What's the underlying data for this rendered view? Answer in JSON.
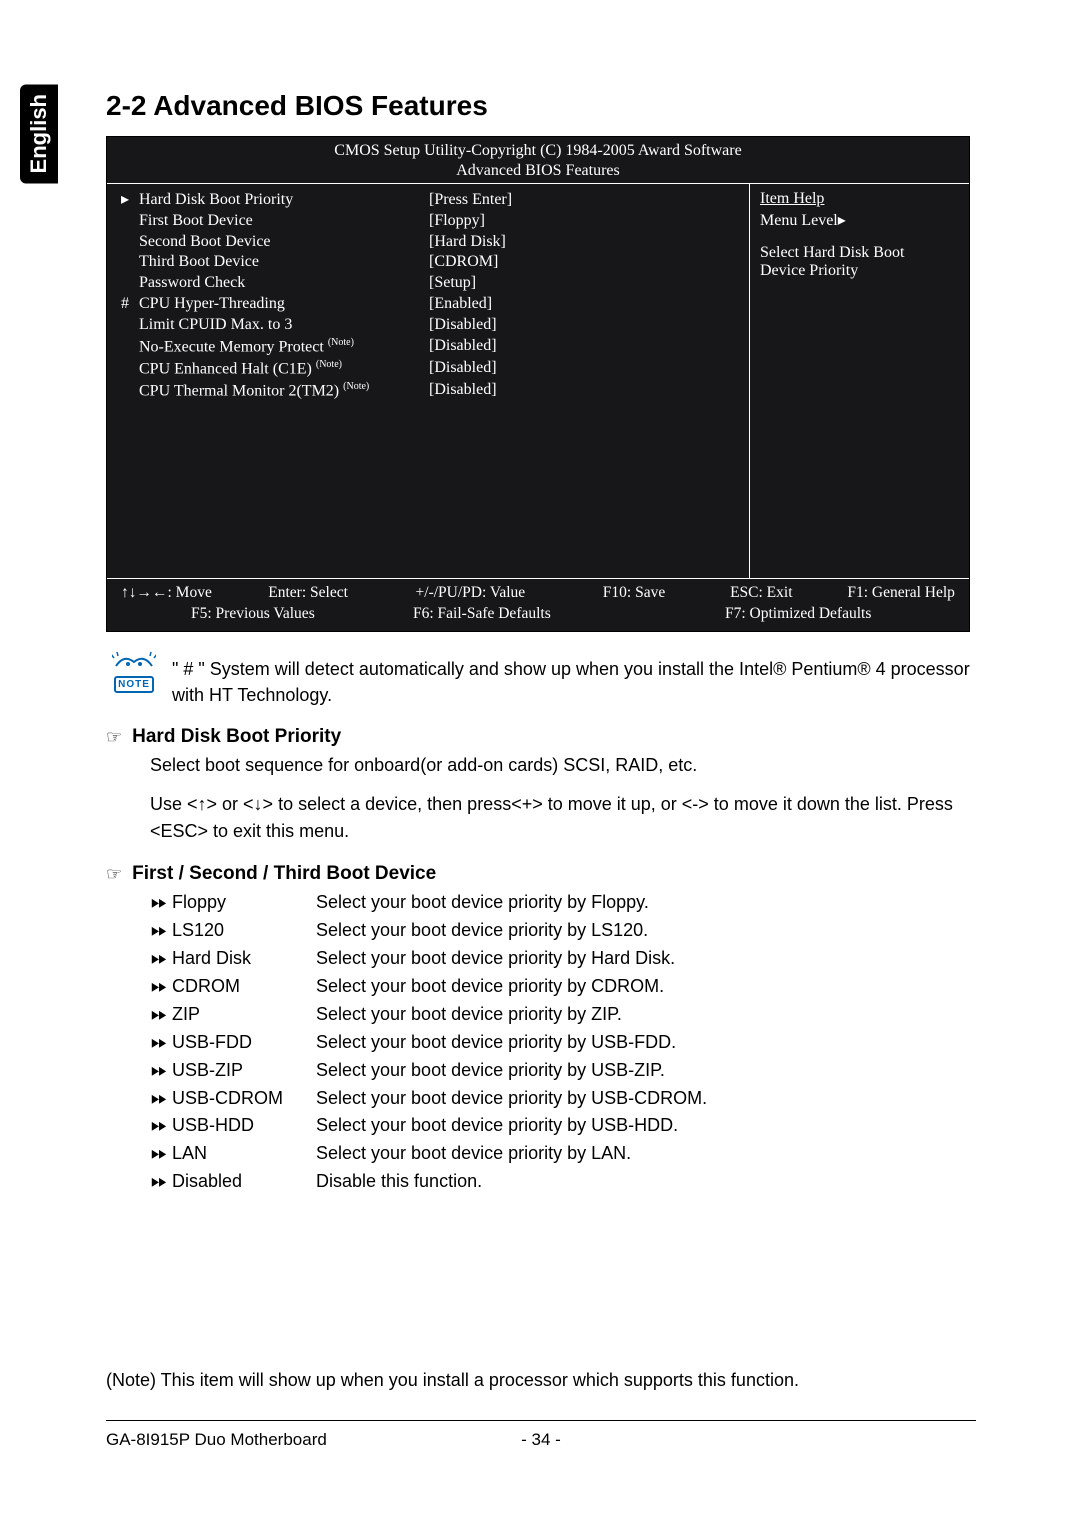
{
  "lang_tab": "English",
  "heading": "2-2    Advanced BIOS Features",
  "bios": {
    "copyright": "CMOS Setup Utility-Copyright (C) 1984-2005 Award Software",
    "subtitle": "Advanced BIOS Features",
    "rows": [
      {
        "mark": "▸",
        "label": "Hard Disk Boot Priority",
        "val": "[Press Enter]"
      },
      {
        "mark": "",
        "label": "First Boot Device",
        "val": "[Floppy]"
      },
      {
        "mark": "",
        "label": "Second Boot Device",
        "val": "[Hard Disk]"
      },
      {
        "mark": "",
        "label": "Third Boot Device",
        "val": "[CDROM]"
      },
      {
        "mark": "",
        "label": "Password Check",
        "val": "[Setup]"
      },
      {
        "mark": "#",
        "label": "CPU Hyper-Threading",
        "val": "[Enabled]"
      },
      {
        "mark": "",
        "label": "Limit CPUID Max. to 3",
        "val": "[Disabled]"
      },
      {
        "mark": "",
        "label": "No-Execute Memory Protect ",
        "note": "(Note)",
        "val": "[Disabled]"
      },
      {
        "mark": "",
        "label": "CPU Enhanced Halt (C1E) ",
        "note": "(Note)",
        "val": "[Disabled]"
      },
      {
        "mark": "",
        "label": "CPU Thermal Monitor 2(TM2) ",
        "note": "(Note)",
        "val": "[Disabled]"
      }
    ],
    "help_title": "Item Help",
    "help_menu": "Menu Level▸",
    "help_text1": "Select Hard Disk Boot",
    "help_text2": "Device Priority",
    "footer": {
      "move": "↑↓→←: Move",
      "enter": "Enter: Select",
      "value": "+/-/PU/PD: Value",
      "save": "F10: Save",
      "esc": "ESC: Exit",
      "f1": "F1: General Help",
      "f5": "F5: Previous Values",
      "f6": "F6: Fail-Safe Defaults",
      "f7": "F7: Optimized Defaults"
    }
  },
  "note_label": "NOTE",
  "note_text": "\" # \" System will detect automatically and show up when you install the Intel® Pentium® 4 processor with HT Technology.",
  "section1": {
    "title": "Hard Disk Boot Priority",
    "p1": "Select boot sequence for onboard(or add-on cards) SCSI, RAID, etc.",
    "p2": "Use <↑> or <↓> to select a device, then press<+> to move it up, or <-> to move it down the list. Press <ESC> to exit this menu."
  },
  "section2": {
    "title": "First / Second / Third Boot Device",
    "options": [
      {
        "name": "Floppy",
        "desc": "Select your boot device priority by Floppy."
      },
      {
        "name": "LS120",
        "desc": "Select your boot device priority by LS120."
      },
      {
        "name": "Hard Disk",
        "desc": "Select your boot device priority by Hard Disk."
      },
      {
        "name": "CDROM",
        "desc": "Select your boot device priority by CDROM."
      },
      {
        "name": "ZIP",
        "desc": "Select your boot device priority by ZIP."
      },
      {
        "name": "USB-FDD",
        "desc": "Select your boot device priority by USB-FDD."
      },
      {
        "name": "USB-ZIP",
        "desc": "Select your boot device priority by USB-ZIP."
      },
      {
        "name": "USB-CDROM",
        "desc": "Select your boot device priority by USB-CDROM."
      },
      {
        "name": "USB-HDD",
        "desc": "Select your boot device priority by USB-HDD."
      },
      {
        "name": "LAN",
        "desc": "Select your boot device priority by LAN."
      },
      {
        "name": "Disabled",
        "desc": "Disable this function."
      }
    ]
  },
  "page_note": "(Note)   This item will show up when you install a processor which supports this function.",
  "footer_model": "GA-8I915P Duo Motherboard",
  "page_number": "- 34 -"
}
